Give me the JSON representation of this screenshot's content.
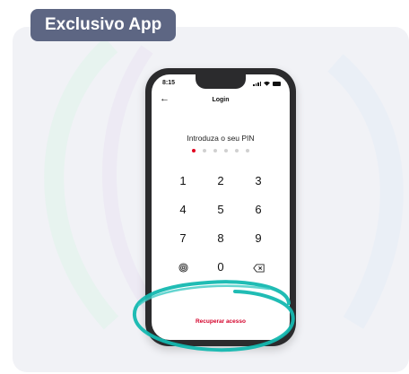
{
  "badge": {
    "text": "Exclusivo App"
  },
  "colors": {
    "badge_bg": "#5d6683",
    "accent_red": "#e1001f",
    "highlight_teal": "#14b8b0",
    "card_bg": "#f1f2f6"
  },
  "phone": {
    "status_bar": {
      "time": "8:15",
      "icons": [
        "signal-icon",
        "wifi-icon",
        "battery-icon"
      ]
    },
    "header": {
      "back_icon": "back-arrow-icon",
      "title": "Login"
    },
    "pin": {
      "prompt": "Introduza o seu PIN",
      "digits_total": 6,
      "digits_entered": 1
    },
    "keypad": {
      "rows": [
        [
          "1",
          "2",
          "3"
        ],
        [
          "4",
          "5",
          "6"
        ],
        [
          "7",
          "8",
          "9"
        ]
      ],
      "zero": "0",
      "left_key_icon": "fingerprint-icon",
      "right_key_icon": "backspace-icon"
    },
    "footer_link": "Recuperar acesso"
  }
}
